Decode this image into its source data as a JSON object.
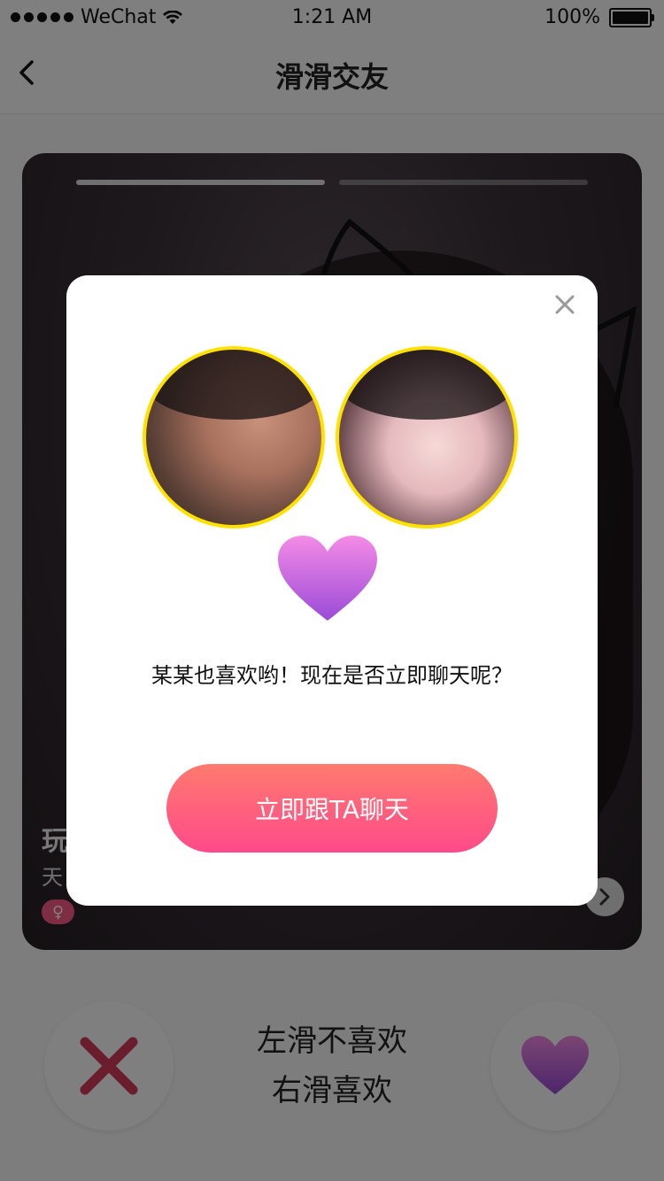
{
  "status_bar": {
    "carrier": "WeChat",
    "time": "1:21 AM",
    "battery": "100%",
    "battery_level": 1.0
  },
  "nav": {
    "title": "滑滑交友",
    "back_icon": "chevron-left-icon"
  },
  "card": {
    "progress": {
      "total": 2,
      "active_index": 0
    },
    "name": "玩",
    "location": "天",
    "gender_badge": "♀",
    "next_icon": "chevron-right-icon"
  },
  "actions": {
    "dislike_icon": "cross-icon",
    "like_icon": "heart-icon",
    "hint_line1": "左滑不喜欢",
    "hint_line2": "右滑喜欢"
  },
  "modal": {
    "close_icon": "close-icon",
    "avatar_left": "male-avatar",
    "avatar_right": "female-avatar",
    "heart_icon": "heart-icon",
    "message": "某某也喜欢哟！现在是否立即聊天呢？",
    "button_label": "立即跟TA聊天"
  },
  "colors": {
    "accent_gradient_start": "#ff7a6f",
    "accent_gradient_end": "#ff4a8a",
    "avatar_border": "#ffe100",
    "heart_top": "#f48be6",
    "heart_bottom": "#9b4bd8",
    "cross": "#d23b5a"
  }
}
